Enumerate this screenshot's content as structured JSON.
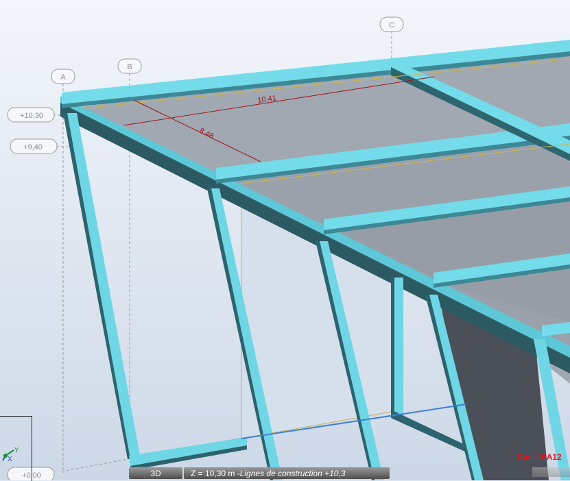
{
  "grid_axes": [
    {
      "label": "A"
    },
    {
      "label": "B"
    },
    {
      "label": "C"
    }
  ],
  "levels": [
    {
      "label": "+10,30"
    },
    {
      "label": "+9,40"
    },
    {
      "label": "+0,00"
    }
  ],
  "dimensions": [
    {
      "label": "10.41"
    },
    {
      "label": "8.48"
    }
  ],
  "status_bar": {
    "view_mode": "3D",
    "z_prefix": "Z = 10,30 m - ",
    "z_detail": "Lignes de construction +10,3"
  },
  "case_label": "Cas: 16A12",
  "axis_triad": {
    "y": "Y",
    "x": "X"
  },
  "colors": {
    "beam": "#6fd6e6",
    "beam_dark": "#2a5860",
    "slab": "#9aa1ab",
    "panel": "#4a4f57",
    "dimension": "#a0161c",
    "case_label": "#e8141a"
  }
}
